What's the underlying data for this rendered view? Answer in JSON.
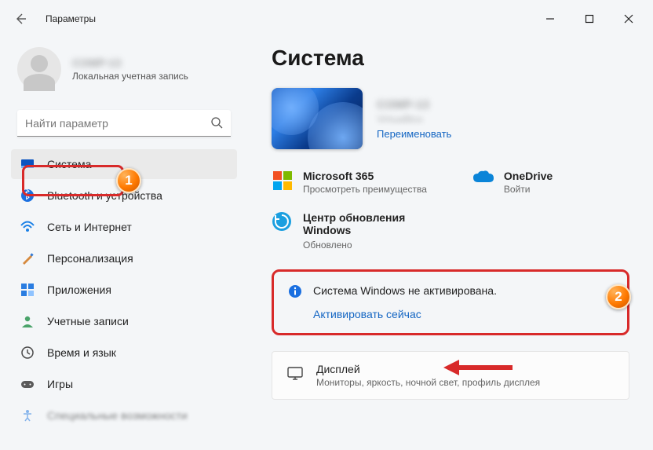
{
  "window": {
    "title": "Параметры"
  },
  "user": {
    "name": "COMP-13",
    "subtitle": "Локальная учетная запись"
  },
  "search": {
    "placeholder": "Найти параметр"
  },
  "nav": {
    "system": "Система",
    "bluetooth": "Bluetooth и устройства",
    "network": "Сеть и Интернет",
    "personalization": "Персонализация",
    "apps": "Приложения",
    "accounts": "Учетные записи",
    "time": "Время и язык",
    "gaming": "Игры",
    "accessibility": "Специальные возможности"
  },
  "main": {
    "heading": "Система",
    "device_name": "COMP-13",
    "device_sub": "VirtualBox",
    "rename": "Переименовать",
    "m365": {
      "title": "Microsoft 365",
      "sub": "Просмотреть преимущества"
    },
    "onedrive": {
      "title": "OneDrive",
      "sub": "Войти"
    },
    "update": {
      "title": "Центр обновления Windows",
      "sub": "Обновлено"
    },
    "activation": {
      "text": "Система Windows не активирована.",
      "link": "Активировать сейчас"
    },
    "display": {
      "title": "Дисплей",
      "sub": "Мониторы, яркость, ночной свет, профиль дисплея"
    }
  },
  "annotations": {
    "step1": "1",
    "step2": "2"
  }
}
